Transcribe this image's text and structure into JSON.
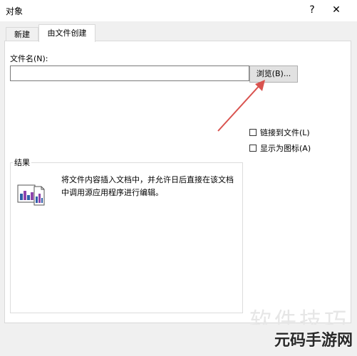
{
  "window": {
    "title": "对象",
    "help_label": "?",
    "close_label": "✕"
  },
  "tabs": [
    {
      "label": "新建",
      "active": false
    },
    {
      "label": "由文件创建",
      "active": true
    }
  ],
  "file": {
    "label": "文件名(N):",
    "value": "",
    "browse_label": "浏览(B)..."
  },
  "options": {
    "link_label": "链接到文件(L)",
    "link_checked": false,
    "display_icon_label": "显示为图标(A)",
    "display_icon_checked": false
  },
  "result": {
    "title": "结果",
    "description": "将文件内容插入文档中，并允许日后直接在该文档中调用源应用程序进行编辑。",
    "icon": "embedded-document-icon"
  },
  "annotation": {
    "arrow_color": "#d9534f"
  },
  "watermark": {
    "text": "软件技巧",
    "brand": "元码手游网"
  },
  "colors": {
    "chart_blue": "#2f5ea8",
    "chart_purple": "#8e44ad",
    "arrow": "#d9534f"
  }
}
